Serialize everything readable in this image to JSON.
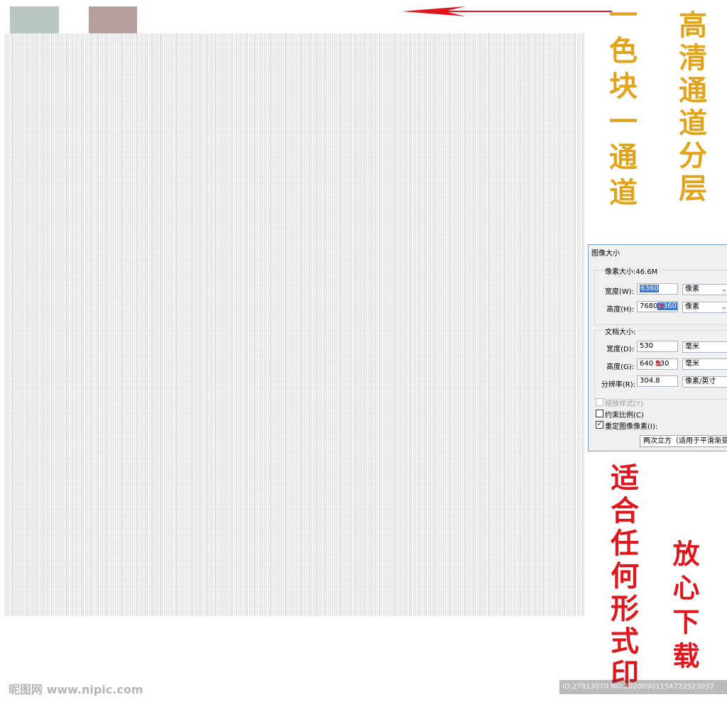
{
  "swatches": {
    "color1": "#b9c6c2",
    "color2": "#b49e9e"
  },
  "arrow_color": "#e0161c",
  "captions": {
    "color_block_channel": "一色块一通道",
    "hd_channel_layers": "高清通道分层",
    "suitable_any_print": "适合任何形式印",
    "download_assured": "放心下载"
  },
  "dialog": {
    "title": "图像大小",
    "pixel_dimensions_label": "像素大小:46.6M",
    "width_label": "宽度(W):",
    "width_value": "6360",
    "width_unit": "像素",
    "height_label": "高度(H):",
    "height_value_old": "7680",
    "height_value_new": "6360",
    "height_unit": "像素",
    "change_mark": "改",
    "doc_size_label": "文档大小:",
    "doc_width_label": "宽度(D):",
    "doc_width_value": "530",
    "doc_width_unit": "毫米",
    "doc_height_label": "高度(G):",
    "doc_height_value_old": "640",
    "doc_height_value_new": "530",
    "doc_height_unit": "毫米",
    "resolution_label": "分辨率(R):",
    "resolution_value": "304.8",
    "resolution_unit": "像素/英寸",
    "scale_styles_label": "缩放样式(Y)",
    "constrain_label": "约束比例(C)",
    "resample_label": "重定图像像素(I):",
    "resample_method": "两次立方（适用于平滑渐变）"
  },
  "watermark": {
    "site": "昵图网 www.nipic.com",
    "id_text": "ID:27813070 NO:20200901154722923037"
  }
}
